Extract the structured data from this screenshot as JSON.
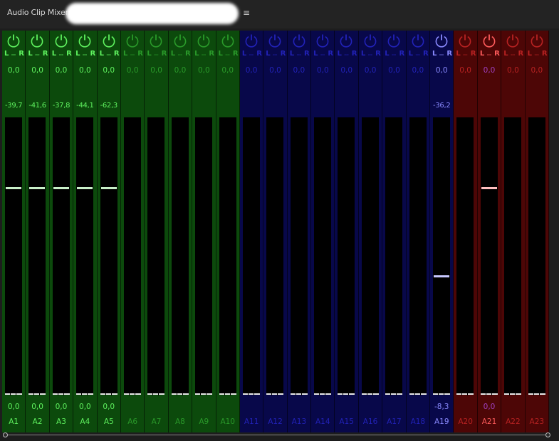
{
  "panel": {
    "title": "Audio Clip Mixer:",
    "menu_glyph": "≡"
  },
  "colors": {
    "green": {
      "on": "#5ff25f",
      "off": "#2a9a2a",
      "handle": "#c8f0c8"
    },
    "blue": {
      "on": "#8a8aff",
      "off": "#2222b8",
      "handle": "#c8c8ff"
    },
    "red": {
      "on": "#ff5c5c",
      "off": "#b82222",
      "handle": "#ffc0c0"
    },
    "neutral_zero": "#a040c0"
  },
  "pan_labels": {
    "left": "L",
    "right": "R",
    "mid": "₀₀₀"
  },
  "channels": [
    {
      "name": "A1",
      "group": "green",
      "active": true,
      "pan": "0,0",
      "peak": "-39,7",
      "volume": "0,0",
      "fader_level": 0.25
    },
    {
      "name": "A2",
      "group": "green",
      "active": true,
      "pan": "0,0",
      "peak": "-41,6",
      "volume": "0,0",
      "fader_level": 0.25
    },
    {
      "name": "A3",
      "group": "green",
      "active": true,
      "pan": "0,0",
      "peak": "-37,8",
      "volume": "0,0",
      "fader_level": 0.25
    },
    {
      "name": "A4",
      "group": "green",
      "active": true,
      "pan": "0,0",
      "peak": "-44,1",
      "volume": "0,0",
      "fader_level": 0.25
    },
    {
      "name": "A5",
      "group": "green",
      "active": true,
      "pan": "0,0",
      "peak": "-62,3",
      "volume": "0,0",
      "fader_level": 0.25
    },
    {
      "name": "A6",
      "group": "green",
      "active": false,
      "pan": "0,0",
      "peak": "",
      "volume": "",
      "fader_level": null
    },
    {
      "name": "A7",
      "group": "green",
      "active": false,
      "pan": "0,0",
      "peak": "",
      "volume": "",
      "fader_level": null
    },
    {
      "name": "A8",
      "group": "green",
      "active": false,
      "pan": "0,0",
      "peak": "",
      "volume": "",
      "fader_level": null
    },
    {
      "name": "A9",
      "group": "green",
      "active": false,
      "pan": "0,0",
      "peak": "",
      "volume": "",
      "fader_level": null
    },
    {
      "name": "A10",
      "group": "green",
      "active": false,
      "pan": "0,0",
      "peak": "",
      "volume": "",
      "fader_level": null
    },
    {
      "name": "A11",
      "group": "blue",
      "active": false,
      "pan": "0,0",
      "peak": "",
      "volume": "",
      "fader_level": null
    },
    {
      "name": "A12",
      "group": "blue",
      "active": false,
      "pan": "0,0",
      "peak": "",
      "volume": "",
      "fader_level": null
    },
    {
      "name": "A13",
      "group": "blue",
      "active": false,
      "pan": "0,0",
      "peak": "",
      "volume": "",
      "fader_level": null
    },
    {
      "name": "A14",
      "group": "blue",
      "active": false,
      "pan": "0,0",
      "peak": "",
      "volume": "",
      "fader_level": null
    },
    {
      "name": "A15",
      "group": "blue",
      "active": false,
      "pan": "0,0",
      "peak": "",
      "volume": "",
      "fader_level": null
    },
    {
      "name": "A16",
      "group": "blue",
      "active": false,
      "pan": "0,0",
      "peak": "",
      "volume": "",
      "fader_level": null
    },
    {
      "name": "A17",
      "group": "blue",
      "active": false,
      "pan": "0,0",
      "peak": "",
      "volume": "",
      "fader_level": null
    },
    {
      "name": "A18",
      "group": "blue",
      "active": false,
      "pan": "0,0",
      "peak": "",
      "volume": "",
      "fader_level": null
    },
    {
      "name": "A19",
      "group": "blue",
      "active": true,
      "pan": "0,0",
      "peak": "-36,2",
      "volume": "-8,3",
      "fader_level": 0.57
    },
    {
      "name": "A20",
      "group": "red",
      "active": false,
      "pan": "0,0",
      "peak": "",
      "volume": "",
      "fader_level": null
    },
    {
      "name": "A21",
      "group": "red",
      "active": true,
      "pan": "0,0",
      "peak": "",
      "volume": "0,0",
      "fader_level": 0.25
    },
    {
      "name": "A22",
      "group": "red",
      "active": false,
      "pan": "0,0",
      "peak": "",
      "volume": "",
      "fader_level": null
    },
    {
      "name": "A23",
      "group": "red",
      "active": false,
      "pan": "0,0",
      "peak": "",
      "volume": "",
      "fader_level": null
    }
  ]
}
